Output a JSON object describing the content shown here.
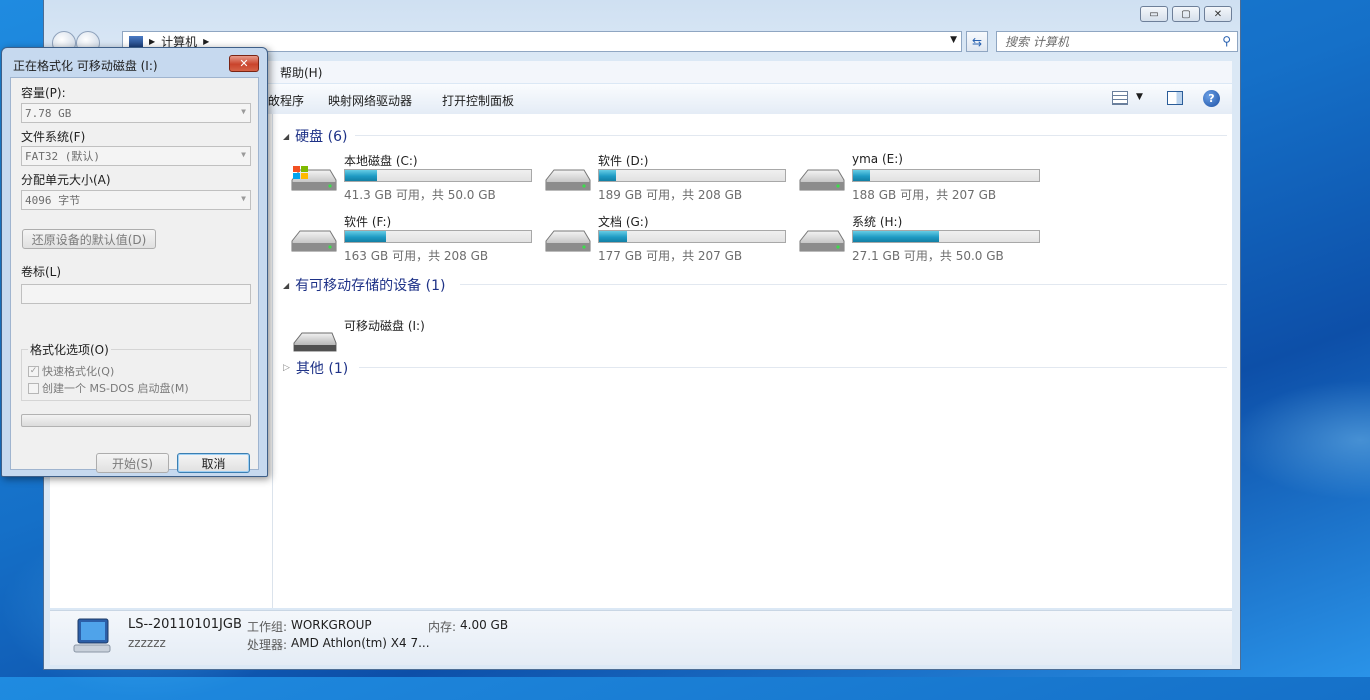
{
  "explorer": {
    "breadcrumb": [
      "计算机"
    ],
    "search_placeholder": "搜索 计算机",
    "menu": [
      "帮助(H)"
    ],
    "toolbar": {
      "partial_item": "敀程序",
      "map_drive": "映射网络驱动器",
      "control_panel": "打开控制面板"
    },
    "caption": {
      "minimize": "▭",
      "maximize": "▢",
      "close": "✕"
    },
    "groups": {
      "hard_disks": {
        "label": "硬盘 (6)"
      },
      "removable": {
        "label": "有可移动存储的设备 (1)"
      },
      "other": {
        "label": "其他 (1)"
      }
    },
    "drives": [
      {
        "name": "本地磁盘 (C:)",
        "free_text": "41.3 GB 可用，共 50.0 GB",
        "used_fraction": 0.17
      },
      {
        "name": "软件 (D:)",
        "free_text": "189 GB 可用，共 208 GB",
        "used_fraction": 0.09
      },
      {
        "name": "yma (E:)",
        "free_text": "188 GB 可用，共 207 GB",
        "used_fraction": 0.09
      },
      {
        "name": "软件 (F:)",
        "free_text": "163 GB 可用，共 208 GB",
        "used_fraction": 0.22
      },
      {
        "name": "文档 (G:)",
        "free_text": "177 GB 可用，共 207 GB",
        "used_fraction": 0.15
      },
      {
        "name": "系统 (H:)",
        "free_text": "27.1 GB 可用，共 50.0 GB",
        "used_fraction": 0.46
      }
    ],
    "removable_drives": [
      {
        "name": "可移动磁盘 (I:)"
      }
    ],
    "details": {
      "computer_name": "LS--20110101JGB",
      "user": "zzzzzz",
      "workgroup_label": "工作组:",
      "workgroup_value": "WORKGROUP",
      "memory_label": "内存:",
      "memory_value": "4.00 GB",
      "cpu_label": "处理器:",
      "cpu_value": "AMD Athlon(tm) X4 7..."
    }
  },
  "dialog": {
    "title": "正在格式化 可移动磁盘 (I:)",
    "close": "✕",
    "capacity_label": "容量(P):",
    "capacity_value": "7.78 GB",
    "fs_label": "文件系统(F)",
    "fs_value": "FAT32 (默认)",
    "alloc_label": "分配单元大小(A)",
    "alloc_value": "4096 字节",
    "restore_button": "还原设备的默认值(D)",
    "volume_label": "卷标(L)",
    "volume_value": "",
    "options_label": "格式化选项(O)",
    "quick_format": "快速格式化(Q)",
    "quick_format_checked": true,
    "msdos_boot": "创建一个 MS-DOS 启动盘(M)",
    "msdos_checked": false,
    "progress": 0,
    "start_button": "开始(S)",
    "cancel_button": "取消"
  }
}
